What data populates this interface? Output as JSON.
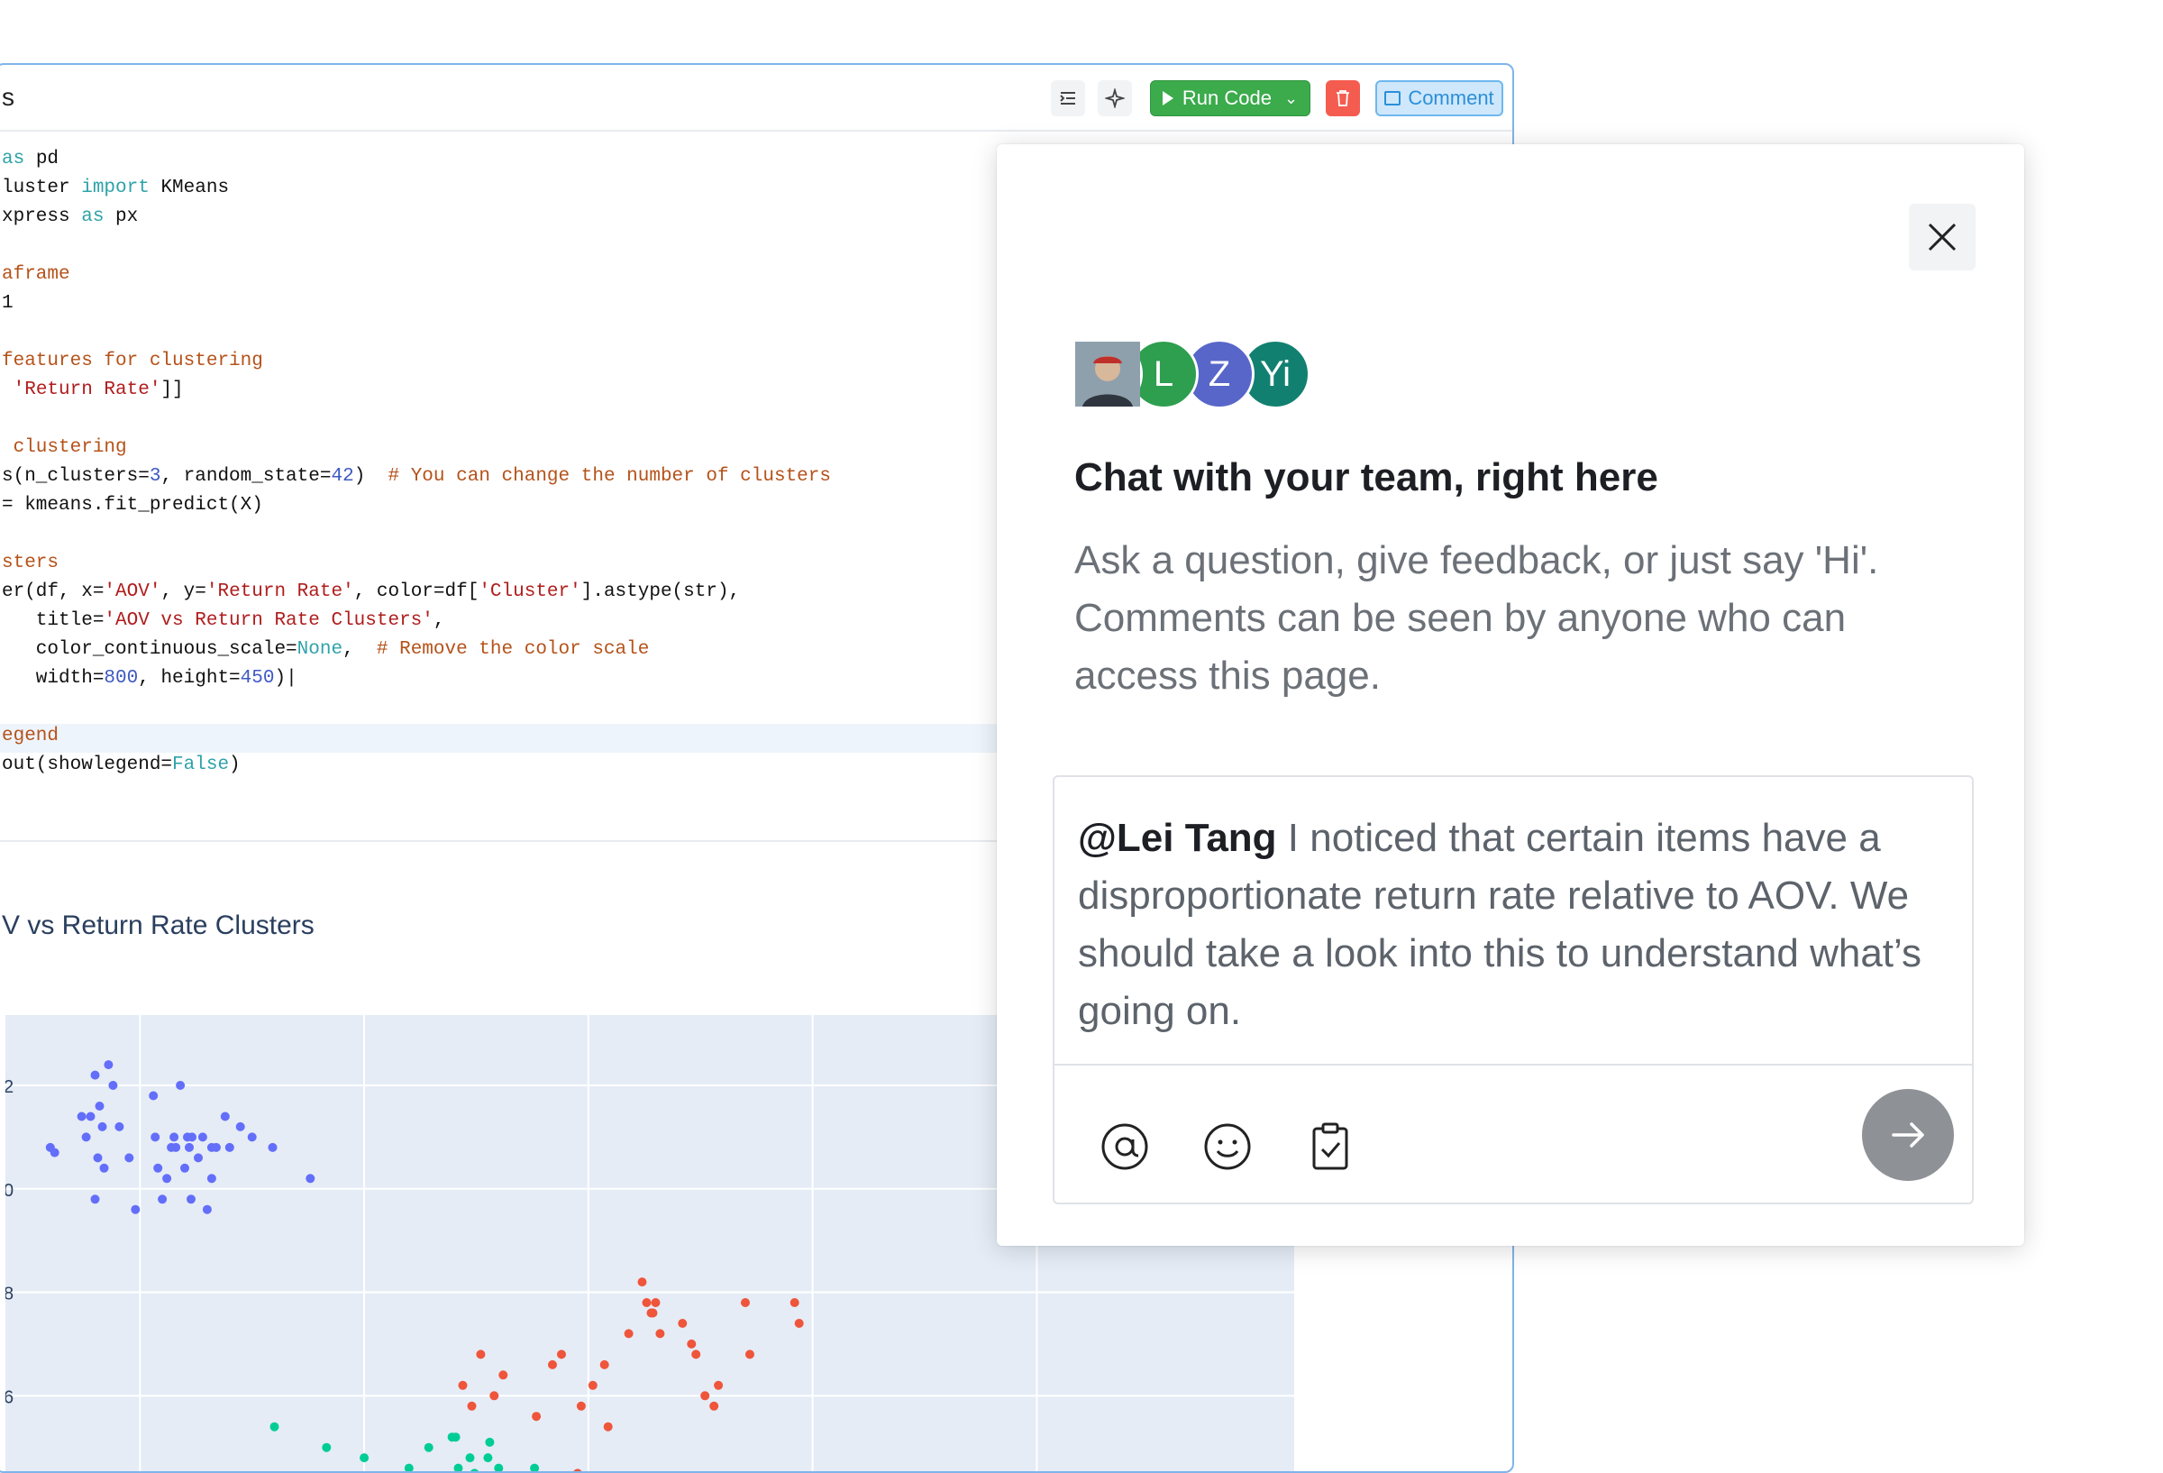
{
  "cell": {
    "title_fragment": "s",
    "toolbar": {
      "run_label": "Run Code",
      "comment_label": "Comment"
    },
    "code_lines": [
      [
        {
          "t": "as",
          "c": "kw"
        },
        {
          "t": " pd"
        }
      ],
      [
        {
          "t": "luster "
        },
        {
          "t": "import",
          "c": "kw"
        },
        {
          "t": " KMeans"
        }
      ],
      [
        {
          "t": "xpress "
        },
        {
          "t": "as",
          "c": "kw"
        },
        {
          "t": " px"
        }
      ],
      [],
      [
        {
          "t": "aframe",
          "c": "cm"
        }
      ],
      [
        {
          "t": "1"
        }
      ],
      [],
      [
        {
          "t": "features for clustering",
          "c": "cm"
        }
      ],
      [
        {
          "t": " "
        },
        {
          "t": "'Return Rate'",
          "c": "st"
        },
        {
          "t": "]]"
        }
      ],
      [],
      [
        {
          "t": " clustering",
          "c": "cm"
        }
      ],
      [
        {
          "t": "s(n_clusters="
        },
        {
          "t": "3",
          "c": "nu"
        },
        {
          "t": ", random_state="
        },
        {
          "t": "42",
          "c": "nu"
        },
        {
          "t": ")  "
        },
        {
          "t": "# You can change the number of clusters",
          "c": "cm"
        }
      ],
      [
        {
          "t": "= kmeans.fit_predict(X)"
        }
      ],
      [],
      [
        {
          "t": "sters",
          "c": "cm"
        }
      ],
      [
        {
          "t": "er(df, x="
        },
        {
          "t": "'AOV'",
          "c": "st"
        },
        {
          "t": ", y="
        },
        {
          "t": "'Return Rate'",
          "c": "st"
        },
        {
          "t": ", color=df["
        },
        {
          "t": "'Cluster'",
          "c": "st"
        },
        {
          "t": "].astype(str),"
        }
      ],
      [
        {
          "t": "   title="
        },
        {
          "t": "'AOV vs Return Rate Clusters'",
          "c": "st"
        },
        {
          "t": ","
        }
      ],
      [
        {
          "t": "   color_continuous_scale="
        },
        {
          "t": "None",
          "c": "kw"
        },
        {
          "t": ",  "
        },
        {
          "t": "# Remove the color scale",
          "c": "cm"
        }
      ],
      [
        {
          "t": "   width="
        },
        {
          "t": "800",
          "c": "nu"
        },
        {
          "t": ", height="
        },
        {
          "t": "450",
          "c": "nu"
        },
        {
          "t": ")|"
        }
      ],
      [],
      [
        {
          "t": "egend",
          "c": "cm"
        }
      ],
      [
        {
          "t": "out(showlegend="
        },
        {
          "t": "False",
          "c": "kw"
        },
        {
          "t": ")"
        }
      ]
    ],
    "plot_title": "V vs Return Rate Clusters",
    "ytick_fragments": [
      "2",
      "0",
      "8",
      "6"
    ]
  },
  "chart_data": {
    "type": "scatter",
    "title": "V vs Return Rate Clusters",
    "xlabel": "",
    "ylabel": "",
    "grid": true,
    "legend": "none",
    "plot_bg": "#e5ecf6",
    "series": [
      {
        "color": "#636efa",
        "x": [
          50,
          55,
          85,
          90,
          95,
          100,
          100,
          103,
          105,
          108,
          110,
          115,
          120,
          127,
          138,
          145,
          165,
          167,
          170,
          175,
          180,
          185,
          188,
          190,
          195,
          200,
          203,
          205,
          207,
          208,
          215,
          220,
          225,
          230,
          230,
          235,
          245,
          250,
          262,
          275,
          298,
          340
        ],
        "y": [
          790,
          785,
          820,
          800,
          820,
          740,
          860,
          780,
          830,
          810,
          770,
          870,
          850,
          810,
          780,
          730,
          840,
          800,
          770,
          740,
          760,
          790,
          800,
          790,
          850,
          770,
          800,
          790,
          740,
          800,
          780,
          800,
          730,
          790,
          760,
          790,
          820,
          790,
          810,
          800,
          790,
          760
        ]
      },
      {
        "color": "#00cc96",
        "x": [
          300,
          358,
          400,
          450,
          458,
          472,
          498,
          502,
          505,
          518,
          523,
          538,
          540,
          550,
          570,
          590
        ],
        "y": [
          520,
          500,
          490,
          480,
          470,
          500,
          510,
          510,
          480,
          490,
          475,
          490,
          505,
          480,
          472,
          480
        ]
      },
      {
        "color": "#ef553b",
        "x": [
          510,
          520,
          530,
          545,
          555,
          592,
          610,
          620,
          638,
          642,
          655,
          668,
          672,
          695,
          710,
          715,
          720,
          722,
          725,
          730,
          755,
          765,
          770,
          780,
          790,
          795,
          825,
          830,
          880,
          885
        ],
        "y": [
          560,
          540,
          590,
          550,
          570,
          530,
          580,
          590,
          475,
          540,
          560,
          580,
          520,
          610,
          660,
          640,
          630,
          630,
          640,
          610,
          620,
          600,
          590,
          550,
          540,
          560,
          640,
          590,
          640,
          620
        ]
      }
    ]
  },
  "chat": {
    "avatars": [
      {
        "initial": "",
        "color": "#6d7a86",
        "photo": true
      },
      {
        "initial": "L",
        "color": "#2e9e4f"
      },
      {
        "initial": "Z",
        "color": "#5866c9"
      },
      {
        "initial": "Yi",
        "color": "#128070"
      }
    ],
    "title": "Chat with your team, right here",
    "description": "Ask a question, give feedback, or just say 'Hi'. Comments can be seen by anyone who can access this page.",
    "mention": "@Lei Tang",
    "message": " I noticed that certain items have a disproportionate return rate relative to AOV. We should take a look into this to understand what’s going on."
  }
}
